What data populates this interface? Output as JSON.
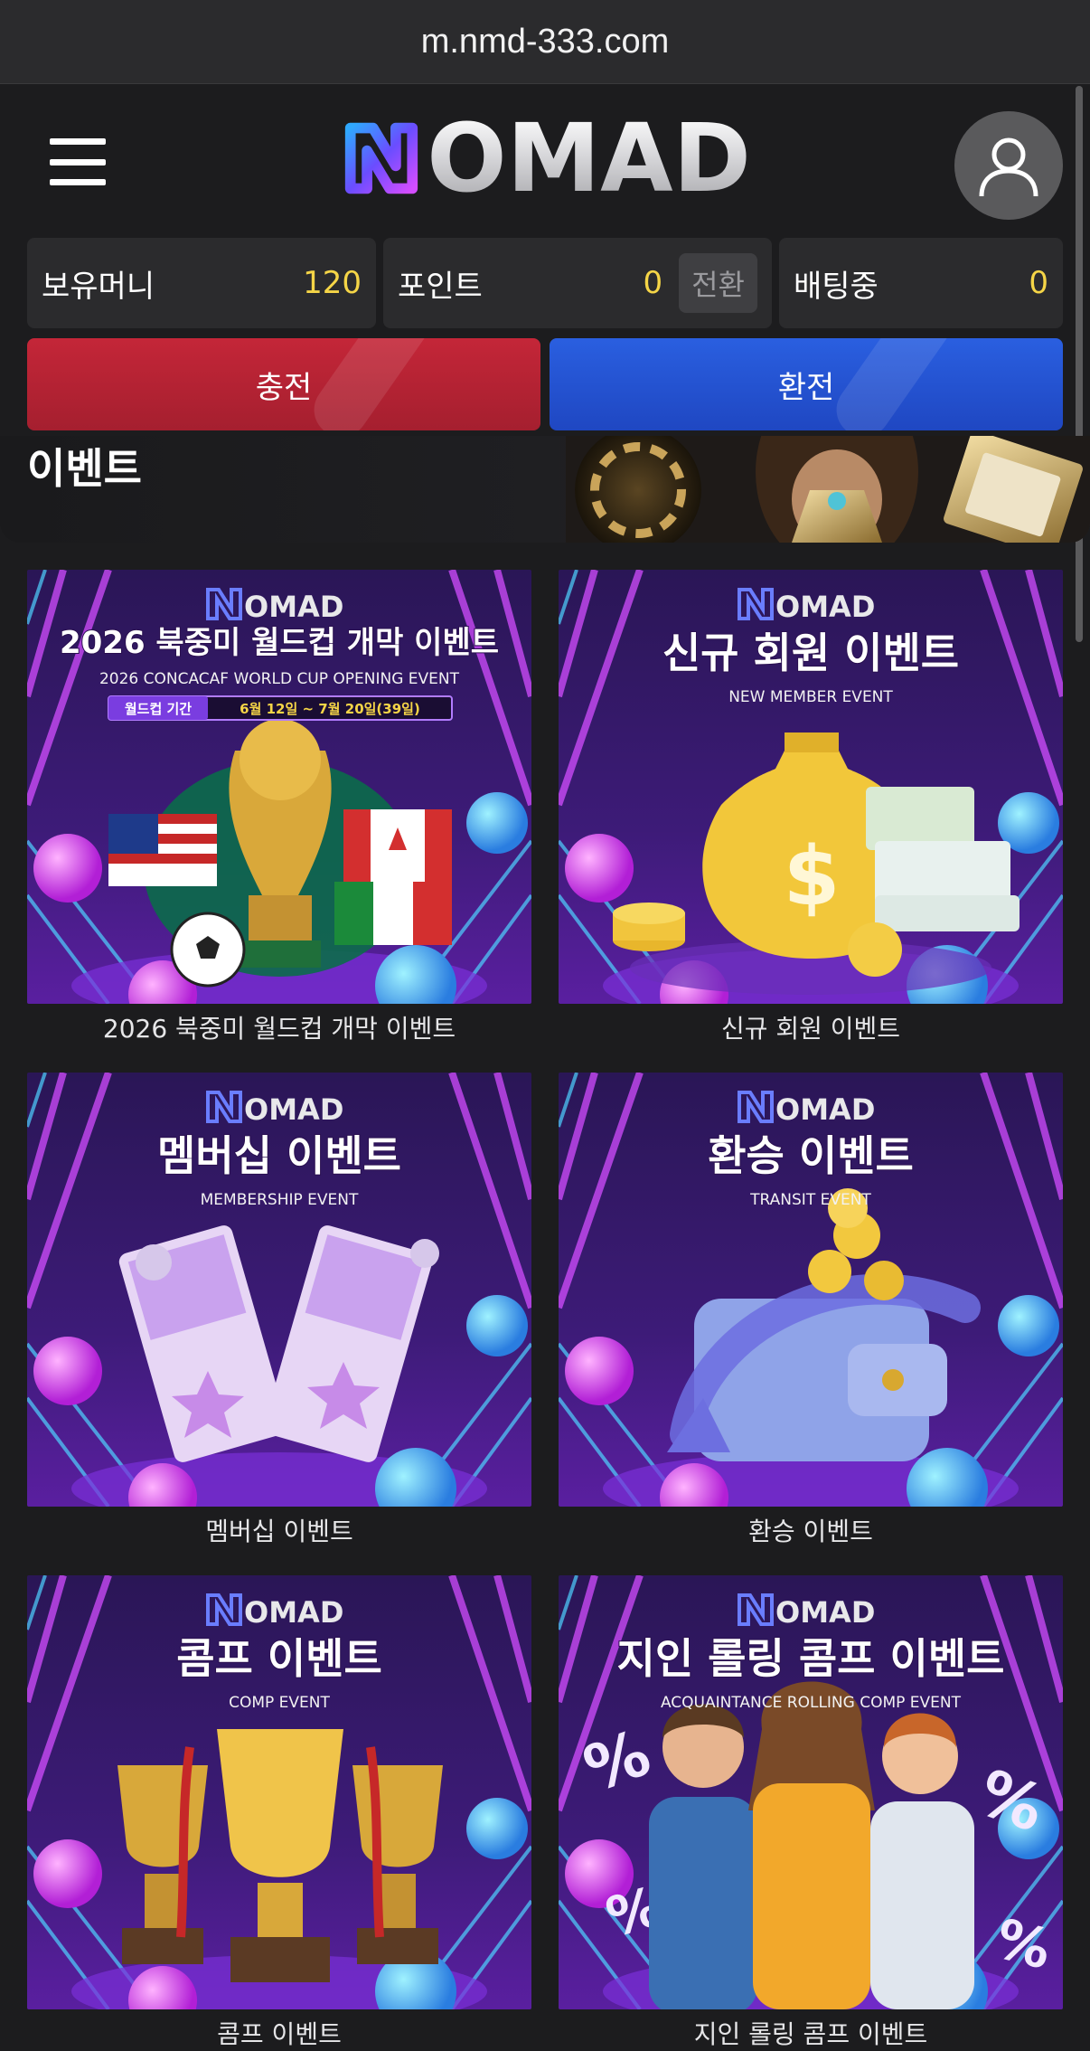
{
  "browser": {
    "url": "m.nmd-333.com"
  },
  "header": {
    "logo_text": "OMAD",
    "logo_brand": "NOMAD"
  },
  "balances": {
    "money_label": "보유머니",
    "money_value": "120",
    "point_label": "포인트",
    "point_value": "0",
    "convert_label": "전환",
    "betting_label": "배팅중",
    "betting_value": "0"
  },
  "actions": {
    "deposit_label": "충전",
    "withdraw_label": "환전"
  },
  "banner": {
    "title": "이벤트"
  },
  "events": [
    {
      "caption": "2026 북중미 월드컵 개막 이벤트",
      "title": "2026 북중미 월드컵 개막 이벤트",
      "subtitle": "2026 CONCACAF WORLD CUP OPENING EVENT",
      "period_label": "월드컵 기간",
      "period": "6월 12일 ~ 7월 20일(39일)",
      "art": "world-cup-trophy"
    },
    {
      "caption": "신규 회원 이벤트",
      "title": "신규 회원 이벤트",
      "subtitle": "NEW MEMBER EVENT",
      "art": "money-bag"
    },
    {
      "caption": "멤버십 이벤트",
      "title": "멤버십 이벤트",
      "subtitle": "MEMBERSHIP EVENT",
      "art": "tickets"
    },
    {
      "caption": "환승 이벤트",
      "title": "환승 이벤트",
      "subtitle": "TRANSIT EVENT",
      "art": "wallet-arrow"
    },
    {
      "caption": "콤프 이벤트",
      "title": "콤프 이벤트",
      "subtitle": "COMP EVENT",
      "art": "trophies"
    },
    {
      "caption": "지인 롤링 콤프 이벤트",
      "title": "지인 롤링 콤프 이벤트",
      "subtitle": "ACQUAINTANCE ROLLING COMP EVENT",
      "art": "friends"
    }
  ],
  "colors": {
    "accent_yellow": "#f5d547",
    "deposit_red": "#c42638",
    "withdraw_blue": "#2a5fe0",
    "card_purple": "#3b1a6b",
    "page_bg": "#1c1c1e"
  }
}
